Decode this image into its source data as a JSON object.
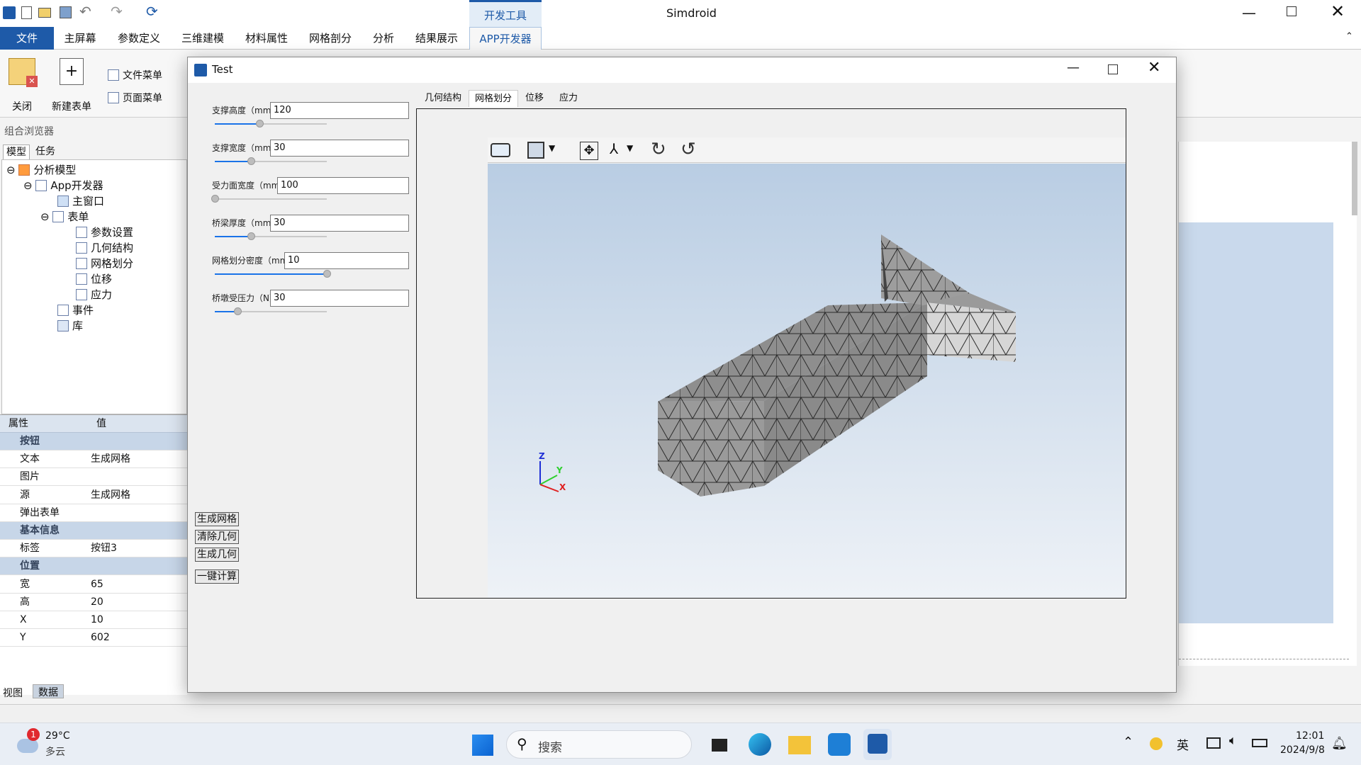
{
  "app": {
    "title": "Simdroid",
    "contextual_tab": "开发工具"
  },
  "menu": [
    "文件",
    "主屏幕",
    "参数定义",
    "三维建模",
    "材料属性",
    "网格剖分",
    "分析",
    "结果展示",
    "APP开发器"
  ],
  "ribbon": {
    "close": "关闭",
    "new_form": "新建表单",
    "file_menu": "文件菜单",
    "page_menu": "页面菜单"
  },
  "browser": {
    "title": "组合浏览器",
    "tabs": [
      "模型",
      "任务"
    ],
    "tree": [
      "分析模型",
      "App开发器",
      "主窗口",
      "表单",
      "参数设置",
      "几何结构",
      "网格划分",
      "位移",
      "应力",
      "事件",
      "库"
    ]
  },
  "props": {
    "header": [
      "属性",
      "值"
    ],
    "rows": [
      {
        "k": "按钮",
        "v": "",
        "g": true
      },
      {
        "k": "文本",
        "v": "生成网格"
      },
      {
        "k": "图片",
        "v": ""
      },
      {
        "k": "源",
        "v": "生成网格"
      },
      {
        "k": "弹出表单",
        "v": ""
      },
      {
        "k": "基本信息",
        "v": "",
        "g": true
      },
      {
        "k": "标签",
        "v": "按钮3"
      },
      {
        "k": "位置",
        "v": "",
        "g": true
      },
      {
        "k": "宽",
        "v": "65"
      },
      {
        "k": "高",
        "v": "20"
      },
      {
        "k": "X",
        "v": "10"
      },
      {
        "k": "Y",
        "v": "602"
      }
    ],
    "bottom_tabs": [
      "视图",
      "数据"
    ]
  },
  "dialog": {
    "title": "Test",
    "fields": [
      {
        "label": "支撑高度（mm）",
        "value": "120",
        "pos": 0.4
      },
      {
        "label": "支撑宽度（mm）",
        "value": "30",
        "pos": 0.32
      },
      {
        "label": "受力面宽度（mm）",
        "value": "100",
        "pos": 0.0
      },
      {
        "label": "桥梁厚度（mm）",
        "value": "30",
        "pos": 0.32
      },
      {
        "label": "网格划分密度（mm）",
        "value": "10",
        "pos": 1.0
      },
      {
        "label": "桥墩受压力（N）",
        "value": "30",
        "pos": 0.2
      }
    ],
    "buttons": [
      "生成网格",
      "清除几何",
      "生成几何",
      "一键计算"
    ],
    "tabs": [
      "几何结构",
      "网格划分",
      "位移",
      "应力"
    ],
    "active_tab": "网格划分",
    "axes": {
      "x": "X",
      "y": "Y",
      "z": "Z"
    }
  },
  "taskbar": {
    "temp": "29°C",
    "weather": "多云",
    "badge": "1",
    "search": "搜索",
    "ime": "英",
    "time": "12:01",
    "date": "2024/9/8"
  },
  "colors": {
    "accent": "#1e5aa8",
    "viewport_top": "#b9cde3",
    "viewport_bottom": "#eef2f7",
    "mesh": "#8e8e8e"
  }
}
